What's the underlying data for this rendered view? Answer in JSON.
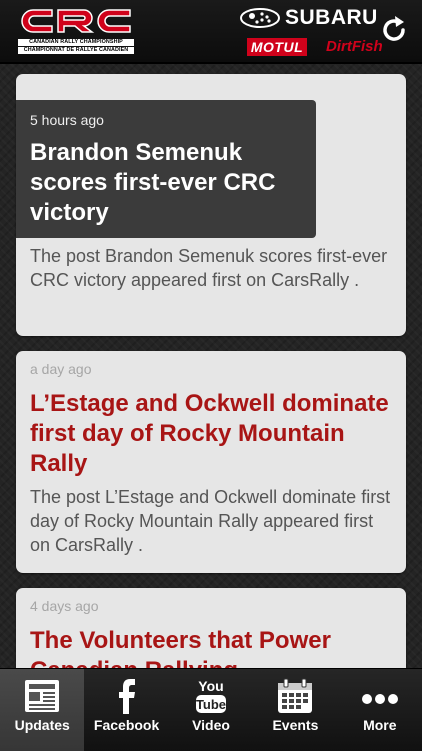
{
  "header": {
    "logo_letters": "CRC",
    "logo_line1": "CANADIAN RALLY CHAMPIONSHIP",
    "logo_line2": "CHAMPIONNAT DE RALLYE CANADIEN",
    "sponsor_subaru": "SUBARU",
    "sponsor_motul": "MOTUL",
    "sponsor_dirtfish": "DirtFish"
  },
  "feed": [
    {
      "time": "5 hours ago",
      "title": "Brandon Semenuk scores first-ever CRC victory",
      "excerpt": "The post Brandon Semenuk scores first-ever CRC victory appeared first on CarsRally ."
    },
    {
      "time": "a day ago",
      "title": "L’Estage and Ockwell dominate first day of Rocky Mountain Rally",
      "excerpt": "The post L’Estage and Ockwell dominate first day of Rocky Mountain Rally appeared first on CarsRally ."
    },
    {
      "time": "4 days ago",
      "title": "The Volunteers that Power Canadian Rallying"
    }
  ],
  "tabs": [
    {
      "label": "Updates",
      "icon": "newspaper-icon"
    },
    {
      "label": "Facebook",
      "icon": "facebook-icon"
    },
    {
      "label": "Video",
      "icon": "youtube-icon"
    },
    {
      "label": "Events",
      "icon": "calendar-icon"
    },
    {
      "label": "More",
      "icon": "more-dots-icon"
    }
  ],
  "video_icon_text": {
    "top": "You",
    "bottom": "Tube"
  },
  "colors": {
    "accent_red": "#a81515",
    "brand_red": "#d0021b"
  }
}
